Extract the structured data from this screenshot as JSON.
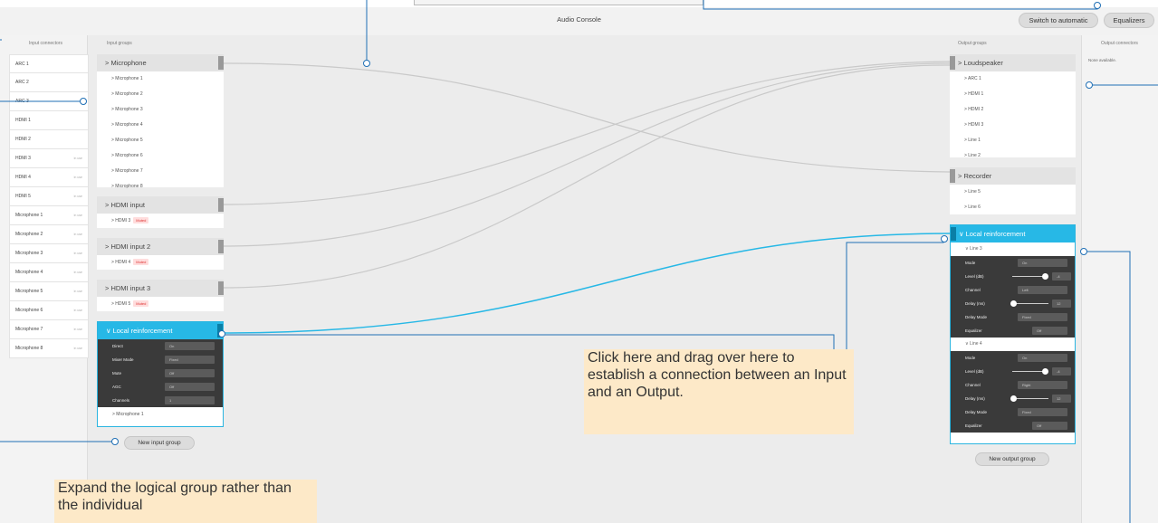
{
  "window": {
    "title": "Audio Console"
  },
  "toolbar": {
    "switch_label": "Switch to automatic",
    "equalizers_label": "Equalizers"
  },
  "columns": {
    "input_connectors": "Input connectors",
    "input_groups": "Input groups",
    "output_groups": "Output groups",
    "output_connectors": "Output connectors"
  },
  "input_connectors": [
    {
      "label": "ARC 1",
      "meta": ""
    },
    {
      "label": "ARC 2",
      "meta": ""
    },
    {
      "label": "ARC 3",
      "meta": ""
    },
    {
      "label": "HDMI 1",
      "meta": ""
    },
    {
      "label": "HDMI 2",
      "meta": ""
    },
    {
      "label": "HDMI 3",
      "meta": "in use"
    },
    {
      "label": "HDMI 4",
      "meta": "in use"
    },
    {
      "label": "HDMI 5",
      "meta": "in use"
    },
    {
      "label": "Microphone 1",
      "meta": "in use"
    },
    {
      "label": "Microphone 2",
      "meta": "in use"
    },
    {
      "label": "Microphone 3",
      "meta": "in use"
    },
    {
      "label": "Microphone 4",
      "meta": "in use"
    },
    {
      "label": "Microphone 5",
      "meta": "in use"
    },
    {
      "label": "Microphone 6",
      "meta": "in use"
    },
    {
      "label": "Microphone 7",
      "meta": "in use"
    },
    {
      "label": "Microphone 8",
      "meta": "in use"
    }
  ],
  "input_groups": {
    "microphone": {
      "header": "> Microphone",
      "items": [
        "> Microphone 1",
        "> Microphone 2",
        "> Microphone 3",
        "> Microphone 4",
        "> Microphone 5",
        "> Microphone 6",
        "> Microphone 7",
        "> Microphone 8"
      ]
    },
    "hdmi_input": {
      "header": "> HDMI input",
      "item": "> HDMI 3"
    },
    "hdmi_input_2": {
      "header": "> HDMI input 2",
      "item": "> HDMI 4"
    },
    "hdmi_input_3": {
      "header": "> HDMI input 3",
      "item": "> HDMI 5"
    },
    "muted_label": "Muted",
    "local_reinforcement": {
      "header": "∨ Local reinforcement",
      "settings": [
        {
          "label": "Direct",
          "value": "On"
        },
        {
          "label": "Mixer Mode",
          "value": "Fixed"
        },
        {
          "label": "Mute",
          "value": "Off"
        },
        {
          "label": "AGC",
          "value": "Off"
        },
        {
          "label": "Channels",
          "value": "1"
        }
      ],
      "item": "> Microphone 1"
    },
    "new_button": "New input group"
  },
  "output_groups": {
    "loudspeaker": {
      "header": "> Loudspeaker",
      "items": [
        "> ARC 1",
        "> HDMI 1",
        "> HDMI 2",
        "> HDMI 3",
        "> Line 1",
        "> Line 2"
      ]
    },
    "recorder": {
      "header": "> Recorder",
      "items": [
        "> Line 5",
        "> Line 6"
      ]
    },
    "local_reinforcement": {
      "header": "∨ Local reinforcement",
      "line3": {
        "header": "∨ Line 3",
        "mode_label": "Mode",
        "mode_value": "On",
        "level_label": "Level (dB)",
        "level_value": "-4",
        "channel_label": "Channel",
        "channel_value": "Left",
        "delay_label": "Delay (ms)",
        "delay_value": "12",
        "delaymode_label": "Delay Mode",
        "delaymode_value": "Fixed",
        "equalizer_label": "Equalizer",
        "equalizer_value": "Off"
      },
      "line4": {
        "header": "∨ Line 4",
        "mode_label": "Mode",
        "mode_value": "On",
        "level_label": "Level (dB)",
        "level_value": "-4",
        "channel_label": "Channel",
        "channel_value": "Right",
        "delay_label": "Delay (ms)",
        "delay_value": "12",
        "delaymode_label": "Delay Mode",
        "delaymode_value": "Fixed",
        "equalizer_label": "Equalizer",
        "equalizer_value": "Off"
      }
    },
    "new_button": "New output group"
  },
  "output_connectors": {
    "empty_text": "None available."
  },
  "annotations": {
    "drag_note": "Click here and drag over here to establish a connection between an Input and an Output.",
    "expand_note": "Expand the logical group rather than the individual"
  },
  "colors": {
    "accent": "#27b8e6",
    "callout": "#1f6fb5",
    "note_bg": "#fde9c8"
  }
}
